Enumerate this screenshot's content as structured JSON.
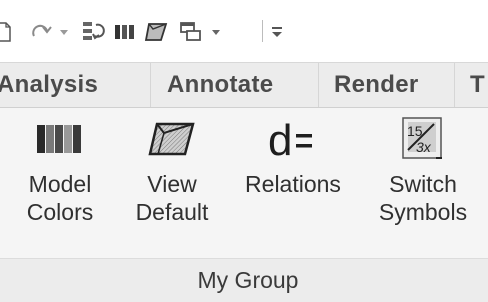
{
  "quick_access": {
    "icons": [
      "new-file-icon",
      "redo-icon",
      "dropdown-arrow-icon",
      "regenerate-icon",
      "model-colors-icon",
      "view-default-icon",
      "windows-icon",
      "dropdown-arrow-icon",
      "customize-arrow-icon"
    ]
  },
  "tabs": [
    {
      "label": "Analysis"
    },
    {
      "label": "Annotate"
    },
    {
      "label": "Render"
    },
    {
      "label": "T"
    }
  ],
  "commands": [
    {
      "line1": "Model",
      "line2": "Colors",
      "icon": "model-colors-icon"
    },
    {
      "line1": "View",
      "line2": "Default",
      "icon": "view-default-icon"
    },
    {
      "line1": "Relations",
      "line2": "",
      "icon": "relations-icon"
    },
    {
      "line1": "Switch",
      "line2": "Symbols",
      "icon": "switch-symbols-icon"
    }
  ],
  "group": {
    "label": "My Group"
  },
  "colors": {
    "tab_bar": "#ececec",
    "panel": "#f5f5f5",
    "text": "#303030"
  }
}
